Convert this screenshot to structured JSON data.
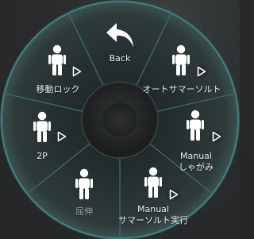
{
  "menu": {
    "items": [
      {
        "id": "back",
        "label": "Back",
        "icon": "back-arrow-icon",
        "has_play": false
      },
      {
        "id": "auto-somersault",
        "label": "オートサマーソルト",
        "icon": "person-icon",
        "has_play": true
      },
      {
        "id": "manual-crouch",
        "label": "Manual\nしゃがみ",
        "label_line1": "Manual",
        "label_line2": "しゃがみ",
        "icon": "person-icon",
        "has_play": true
      },
      {
        "id": "manual-somersault",
        "label_line1": "Manual",
        "label_line2": "サマーソルト実行",
        "icon": "person-icon",
        "has_play": false
      },
      {
        "id": "stretch",
        "label": "屈伸",
        "icon": "person-icon",
        "has_play": false,
        "dimmed": true
      },
      {
        "id": "2p",
        "label": "2P",
        "icon": "person-icon",
        "has_play": true
      },
      {
        "id": "move-lock",
        "label": "移動ロック",
        "icon": "person-icon",
        "has_play": true
      }
    ],
    "center": {
      "icon": "joystick-center-icon"
    }
  },
  "colors": {
    "ring_fill": "#2c3535",
    "ring_edge": "#4fa3a3",
    "divider": "#3f6c6c",
    "text": "#e9eeee",
    "text_dim": "#9fa6a6",
    "icon": "#ffffff"
  }
}
